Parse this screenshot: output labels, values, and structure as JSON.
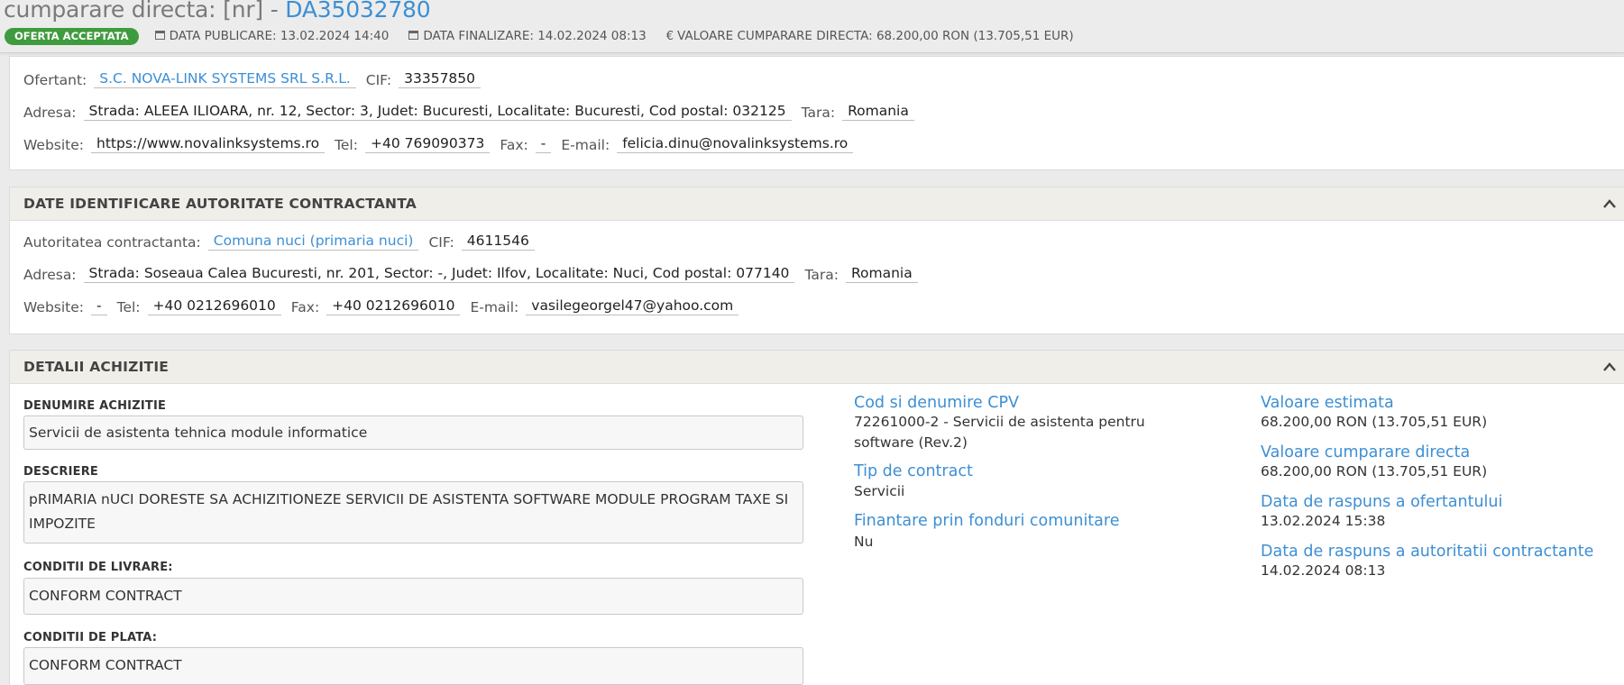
{
  "header": {
    "title_prefix": "cumparare directa: [nr] - ",
    "title_code": "DA35032780",
    "status_badge": "OFERTA ACCEPTATA",
    "publication_date": "DATA PUBLICARE: 13.02.2024 14:40",
    "finalization_date": "DATA FINALIZARE: 14.02.2024 08:13",
    "direct_purchase_value": "VALOARE CUMPARARE DIRECTA: 68.200,00  RON (13.705,51  EUR)"
  },
  "bidder": {
    "label_bidder": "Ofertant:",
    "bidder_name": "S.C. NOVA-LINK SYSTEMS SRL S.R.L.",
    "label_cif": "CIF:",
    "cif": "33357850",
    "label_address": "Adresa:",
    "address": "Strada: ALEEA ILIOARA, nr. 12, Sector: 3, Judet: Bucuresti, Localitate: Bucuresti, Cod postal: 032125",
    "label_country": "Tara:",
    "country": "Romania",
    "label_website": "Website:",
    "website": "https://www.novalinksystems.ro",
    "label_tel": "Tel:",
    "tel": "+40 769090373",
    "label_fax": "Fax:",
    "fax": "-",
    "label_email": "E-mail:",
    "email": "felicia.dinu@novalinksystems.ro"
  },
  "authority": {
    "section_title": "DATE IDENTIFICARE AUTORITATE CONTRACTANTA",
    "label_authority": "Autoritatea contractanta:",
    "authority_name": "Comuna nuci (primaria nuci)",
    "label_cif": "CIF:",
    "cif": "4611546",
    "label_address": "Adresa:",
    "address": "Strada: Soseaua Calea Bucuresti, nr. 201, Sector: -, Judet: Ilfov, Localitate: Nuci, Cod postal: 077140",
    "label_country": "Tara:",
    "country": "Romania",
    "label_website": "Website:",
    "website": "-",
    "label_tel": "Tel:",
    "tel": "+40 0212696010",
    "label_fax": "Fax:",
    "fax": "+40 0212696010",
    "label_email": "E-mail:",
    "email": "vasilegeorgel47@yahoo.com"
  },
  "details": {
    "section_title": "DETALII ACHIZITIE",
    "label_name": "DENUMIRE ACHIZITIE",
    "name": "Servicii de asistenta tehnica module informatice",
    "label_description": "DESCRIERE",
    "description": "pRIMARIA nUCI DORESTE SA ACHIZITIONEZE SERVICII DE ASISTENTA SOFTWARE MODULE PROGRAM TAXE SI IMPOZITE",
    "label_delivery": "CONDITII DE LIVRARE:",
    "delivery": "CONFORM CONTRACT",
    "label_payment": "CONDITII DE PLATA:",
    "payment": "CONFORM CONTRACT",
    "cpv_title": "Cod si denumire CPV",
    "cpv_value": "72261000-2 - Servicii de asistenta pentru software (Rev.2)",
    "contract_type_title": "Tip de contract",
    "contract_type_value": "Servicii",
    "eu_funds_title": "Finantare prin fonduri comunitare",
    "eu_funds_value": "Nu",
    "estimated_value_title": "Valoare estimata",
    "estimated_value": "68.200,00  RON (13.705,51  EUR)",
    "direct_value_title": "Valoare cumparare directa",
    "direct_value": "68.200,00  RON (13.705,51  EUR)",
    "bidder_response_title": "Data de raspuns a ofertantului",
    "bidder_response_value": "13.02.2024 15:38",
    "authority_response_title": "Data de raspuns a autoritatii contractante",
    "authority_response_value": "14.02.2024 08:13"
  }
}
